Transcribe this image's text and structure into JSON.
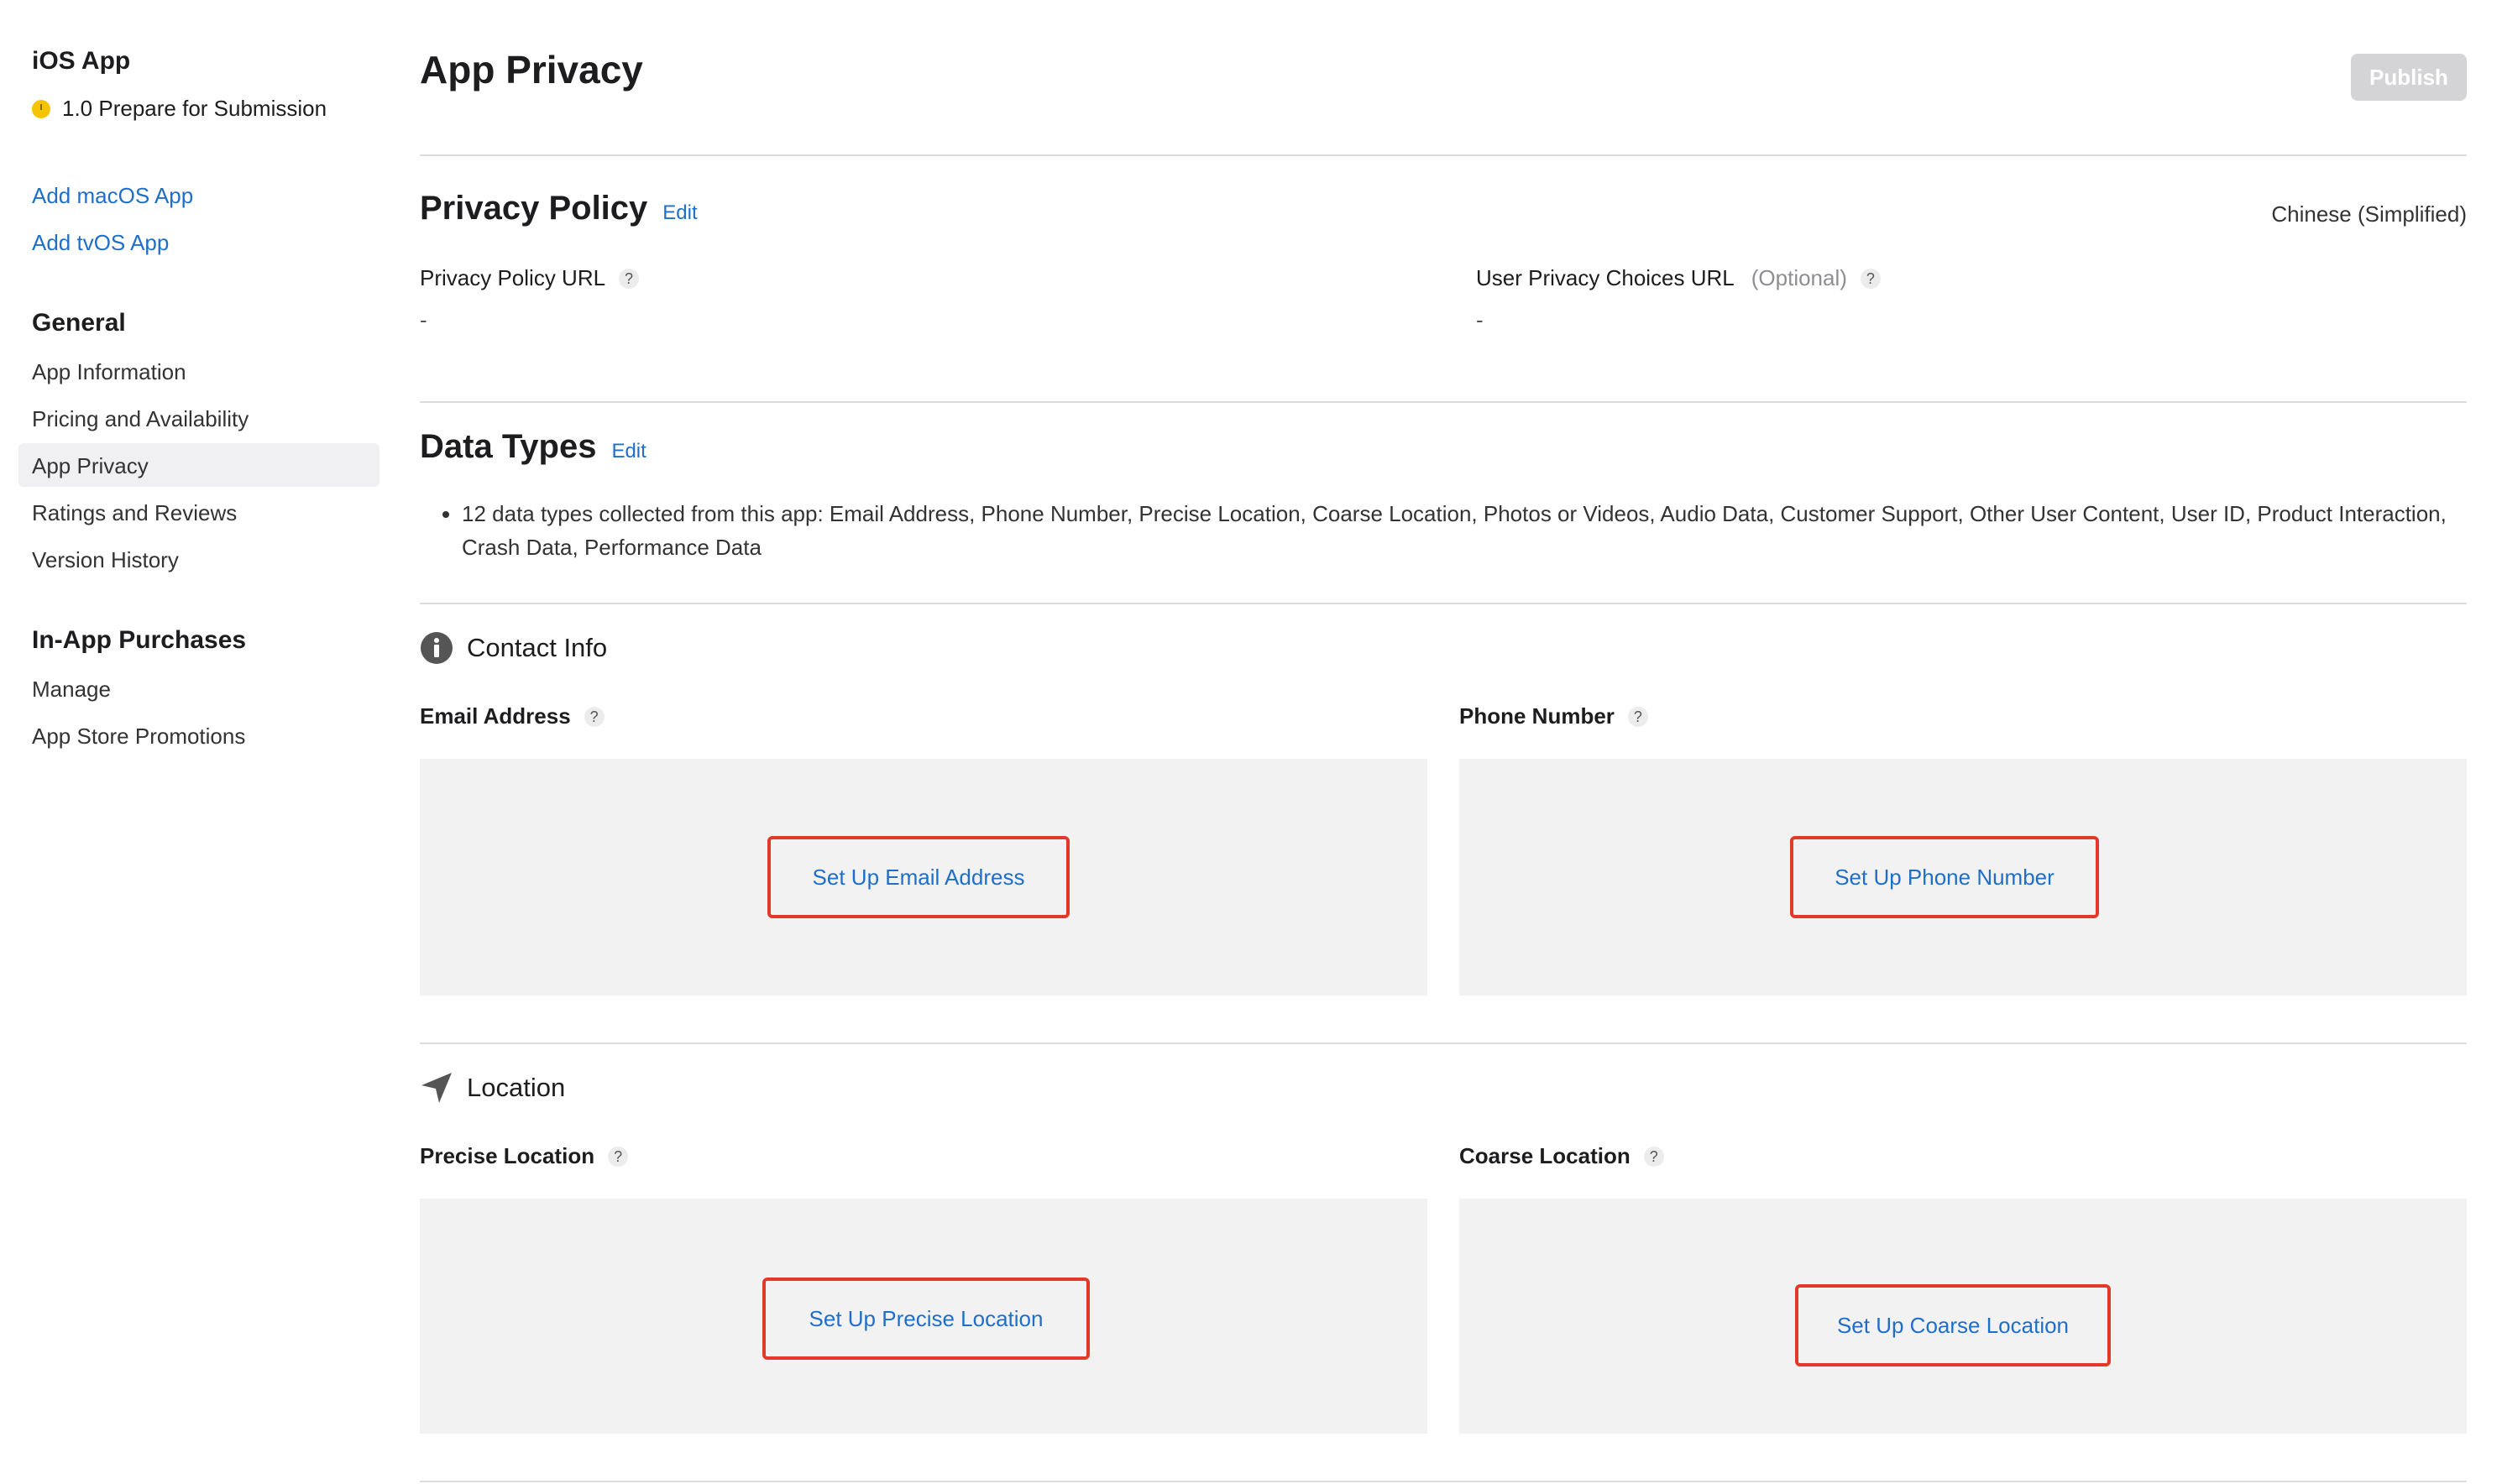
{
  "sidebar": {
    "app_title": "iOS App",
    "version_status": "1.0 Prepare for Submission",
    "add_links": [
      "Add macOS App",
      "Add tvOS App"
    ],
    "general_heading": "General",
    "general_items": [
      "App Information",
      "Pricing and Availability",
      "App Privacy",
      "Ratings and Reviews",
      "Version History"
    ],
    "active_item": "App Privacy",
    "iap_heading": "In-App Purchases",
    "iap_items": [
      "Manage",
      "App Store Promotions"
    ]
  },
  "header": {
    "title": "App Privacy",
    "publish_label": "Publish"
  },
  "privacy_policy": {
    "heading": "Privacy Policy",
    "edit_label": "Edit",
    "language": "Chinese (Simplified)",
    "policy_url_label": "Privacy Policy URL",
    "policy_url_value": "-",
    "choices_url_label": "User Privacy Choices URL",
    "choices_optional": "(Optional)",
    "choices_url_value": "-",
    "help_glyph": "?"
  },
  "data_types": {
    "heading": "Data Types",
    "edit_label": "Edit",
    "summary": "12 data types collected from this app: Email Address, Phone Number, Precise Location, Coarse Location, Photos or Videos, Audio Data, Customer Support, Other User Content, User ID, Product Interaction, Crash Data, Performance Data"
  },
  "contact_info": {
    "heading": "Contact Info",
    "icon": "info-circle-icon",
    "email_label": "Email Address",
    "email_button": "Set Up Email Address",
    "phone_label": "Phone Number",
    "phone_button": "Set Up Phone Number"
  },
  "location": {
    "heading": "Location",
    "icon": "location-arrow-icon",
    "precise_label": "Precise Location",
    "precise_button": "Set Up Precise Location",
    "coarse_label": "Coarse Location",
    "coarse_button": "Set Up Coarse Location"
  },
  "colors": {
    "link": "#1f6fc9",
    "highlight_border": "#e2392b",
    "status_dot": "#f5c400",
    "panel_bg": "#f2f2f2"
  }
}
